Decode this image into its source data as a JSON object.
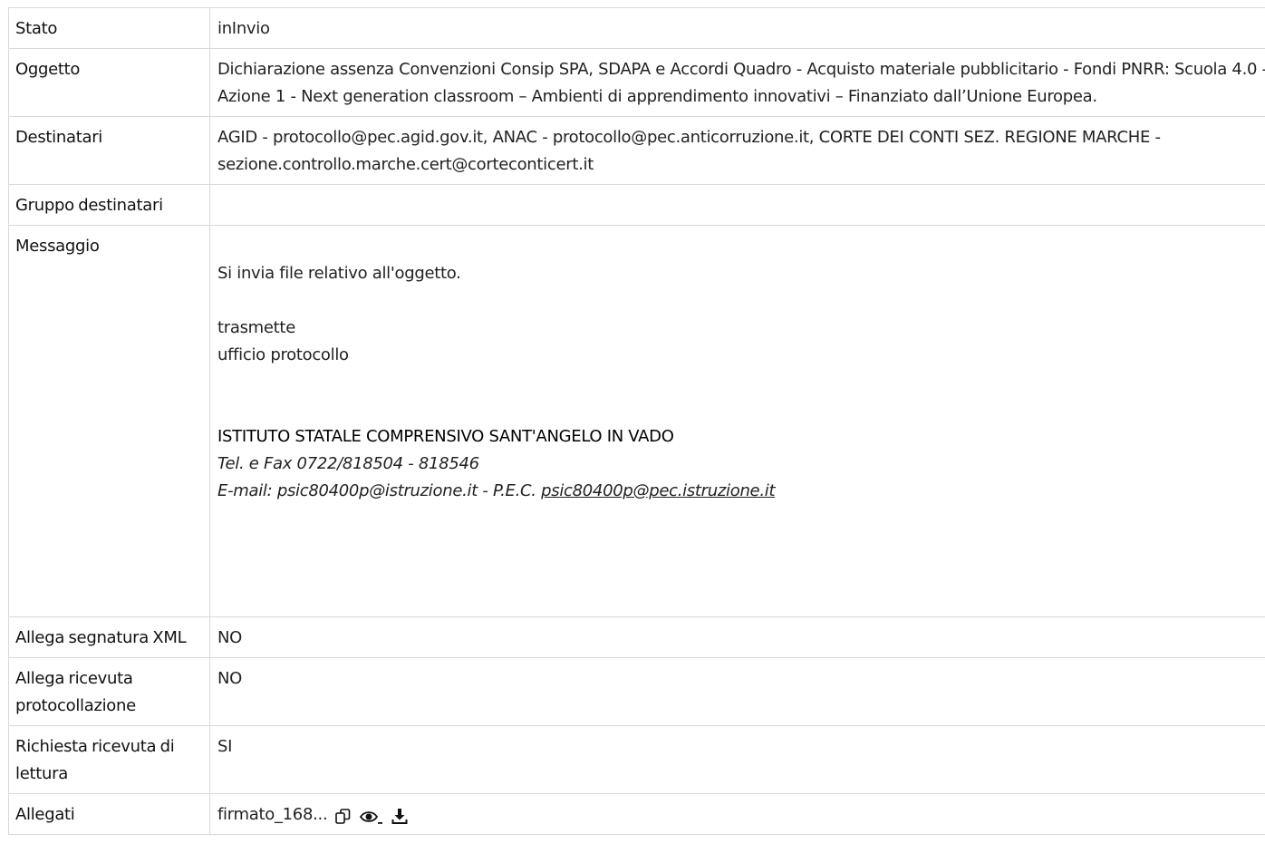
{
  "rows": {
    "stato": {
      "label": "Stato",
      "value": "inInvio"
    },
    "oggetto": {
      "label": "Oggetto",
      "value": "Dichiarazione assenza Convenzioni Consip SPA, SDAPA e Accordi Quadro - Acquisto materiale pubblicitario - Fondi PNRR: Scuola 4.0 - Azione 1 - Next generation classroom – Ambienti di apprendimento innovativi – Finanziato dall’Unione Europea."
    },
    "destinatari": {
      "label": "Destinatari",
      "value": "AGID - protocollo@pec.agid.gov.it, ANAC - protocollo@pec.anticorruzione.it, CORTE DEI CONTI SEZ. REGIONE MARCHE - sezione.controllo.marche.cert@corteconticert.it"
    },
    "gruppo_destinatari": {
      "label": "Gruppo destinatari",
      "value": ""
    },
    "messaggio": {
      "label": "Messaggio",
      "line1": "Si invia file relativo all'oggetto.",
      "line2": "trasmette",
      "line3": "ufficio protocollo",
      "org": "ISTITUTO STATALE COMPRENSIVO SANT'ANGELO IN VADO",
      "tel": "Tel. e Fax 0722/818504 - 818546",
      "email_prefix": "E-mail: psic80400p@istruzione.it - P.E.C.",
      "pec": "psic80400p@pec.istruzione.it"
    },
    "allega_segnatura": {
      "label": "Allega segnatura XML",
      "value": "NO"
    },
    "allega_ricevuta": {
      "label": "Allega ricevuta protocollazione",
      "value": "NO"
    },
    "richiesta_ricevuta": {
      "label": "Richiesta ricevuta di lettura",
      "value": "SI"
    },
    "allegati": {
      "label": "Allegati",
      "file": "firmato_168..."
    }
  },
  "icons": {
    "copy": "copy-icon",
    "view": "eye-icon",
    "download": "download-icon"
  }
}
